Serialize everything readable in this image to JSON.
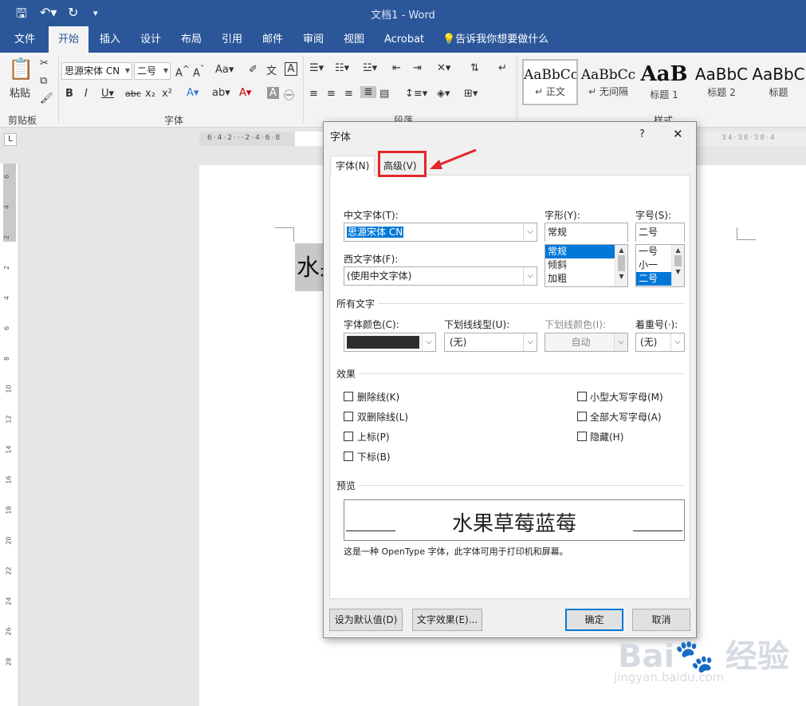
{
  "titlebar": {
    "doc_title": "文档1  -  Word"
  },
  "ribbon_tabs": [
    {
      "label": "文件"
    },
    {
      "label": "开始"
    },
    {
      "label": "插入"
    },
    {
      "label": "设计"
    },
    {
      "label": "布局"
    },
    {
      "label": "引用"
    },
    {
      "label": "邮件"
    },
    {
      "label": "审阅"
    },
    {
      "label": "视图"
    },
    {
      "label": "Acrobat"
    }
  ],
  "tell_me": "告诉我你想要做什么",
  "ribbon": {
    "paste_label": "粘贴",
    "clipboard_label": "剪贴板",
    "font_name": "思源宋体 CN",
    "font_size": "二号",
    "font_group_label": "字体",
    "paragraph_group_label": "段落",
    "styles_group_label": "样式",
    "styles": [
      {
        "preview": "AaBbCc",
        "name": "↵ 正文"
      },
      {
        "preview": "AaBbCc",
        "name": "↵ 无间隔"
      },
      {
        "preview": "AaB",
        "name": "标题 1"
      },
      {
        "preview": "AaBbC",
        "name": "标题 2"
      },
      {
        "preview": "AaBbC",
        "name": "标题"
      }
    ]
  },
  "ruler_marks": [
    "6",
    "4",
    "2",
    "2",
    "4",
    "6",
    "8",
    "10",
    "12",
    "14",
    "16",
    "18",
    "20",
    "22",
    "24",
    "26",
    "28"
  ],
  "hruler_marks": [
    "6",
    "4",
    "2",
    "2",
    "4",
    "6",
    "8",
    "34",
    "36",
    "38",
    "4"
  ],
  "document": {
    "selected_text": "水果"
  },
  "dialog": {
    "title": "字体",
    "help": "?",
    "close": "✕",
    "tabs": [
      {
        "label": "字体(N)"
      },
      {
        "label": "高级(V)"
      }
    ],
    "chinese_font_label": "中文字体(T):",
    "chinese_font_value": "思源宋体 CN",
    "western_font_label": "西文字体(F):",
    "western_font_value": "(使用中文字体)",
    "style_label": "字形(Y):",
    "style_value": "常规",
    "style_options": [
      "常规",
      "倾斜",
      "加粗"
    ],
    "size_label": "字号(S):",
    "size_value": "二号",
    "size_options": [
      "一号",
      "小一",
      "二号"
    ],
    "all_text_label": "所有文字",
    "font_color_label": "字体颜色(C):",
    "font_color_value": "#2d2d2d",
    "underline_style_label": "下划线线型(U):",
    "underline_style_value": "(无)",
    "underline_color_label": "下划线颜色(I):",
    "underline_color_value": "自动",
    "emphasis_label": "着重号(·):",
    "emphasis_value": "(无)",
    "effects_label": "效果",
    "effects_left": [
      {
        "label": "删除线(K)"
      },
      {
        "label": "双删除线(L)"
      },
      {
        "label": "上标(P)"
      },
      {
        "label": "下标(B)"
      }
    ],
    "effects_right": [
      {
        "label": "小型大写字母(M)"
      },
      {
        "label": "全部大写字母(A)"
      },
      {
        "label": "隐藏(H)"
      }
    ],
    "preview_label": "预览",
    "preview_text": "水果草莓蓝莓",
    "preview_note": "这是一种 OpenType 字体，此字体可用于打印机和屏幕。",
    "set_default_button": "设为默认值(D)",
    "text_effects_button": "文字效果(E)...",
    "ok_button": "确定",
    "cancel_button": "取消"
  },
  "colors": {
    "title_bar": "#2b579a",
    "accent": "#0078d7",
    "annotation": "#e3262b"
  }
}
